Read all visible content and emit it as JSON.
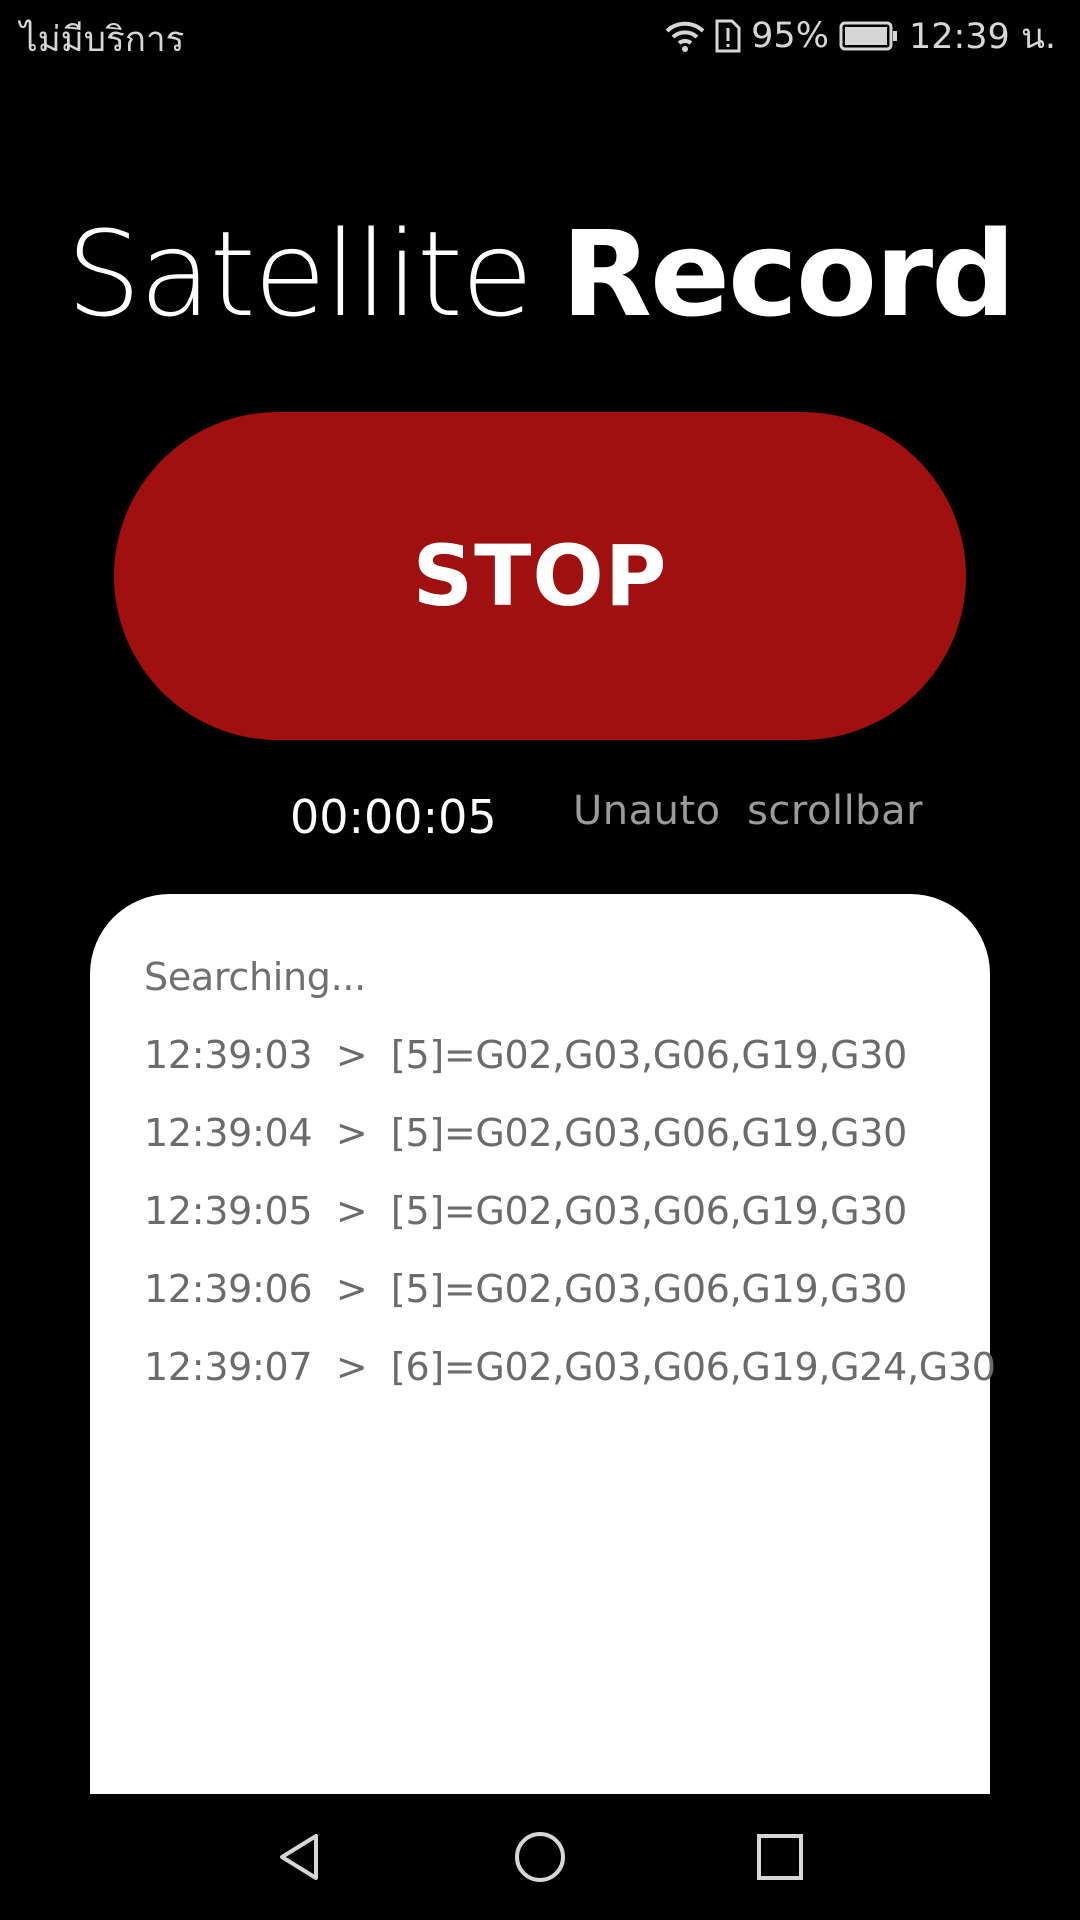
{
  "status_bar": {
    "carrier": "ไม่มีบริการ",
    "battery_percent": "95%",
    "time": "12:39 น.",
    "icons": [
      "wifi-icon",
      "sim-alert-icon",
      "battery-icon"
    ]
  },
  "title": {
    "light": "Satellite",
    "bold": "Record"
  },
  "stop_button": {
    "label": "STOP",
    "color": "#a11010"
  },
  "timer": "00:00:05",
  "scroll_toggle": "Unauto  scrollbar",
  "log": {
    "status": "Searching...",
    "lines": [
      "12:39:03  >  [5]=G02,G03,G06,G19,G30",
      "12:39:04  >  [5]=G02,G03,G06,G19,G30",
      "12:39:05  >  [5]=G02,G03,G06,G19,G30",
      "12:39:06  >  [5]=G02,G03,G06,G19,G30",
      "12:39:07  >  [6]=G02,G03,G06,G19,G24,G30"
    ]
  },
  "nav_bar": {
    "icons": [
      "back-icon",
      "home-icon",
      "recents-icon"
    ]
  }
}
